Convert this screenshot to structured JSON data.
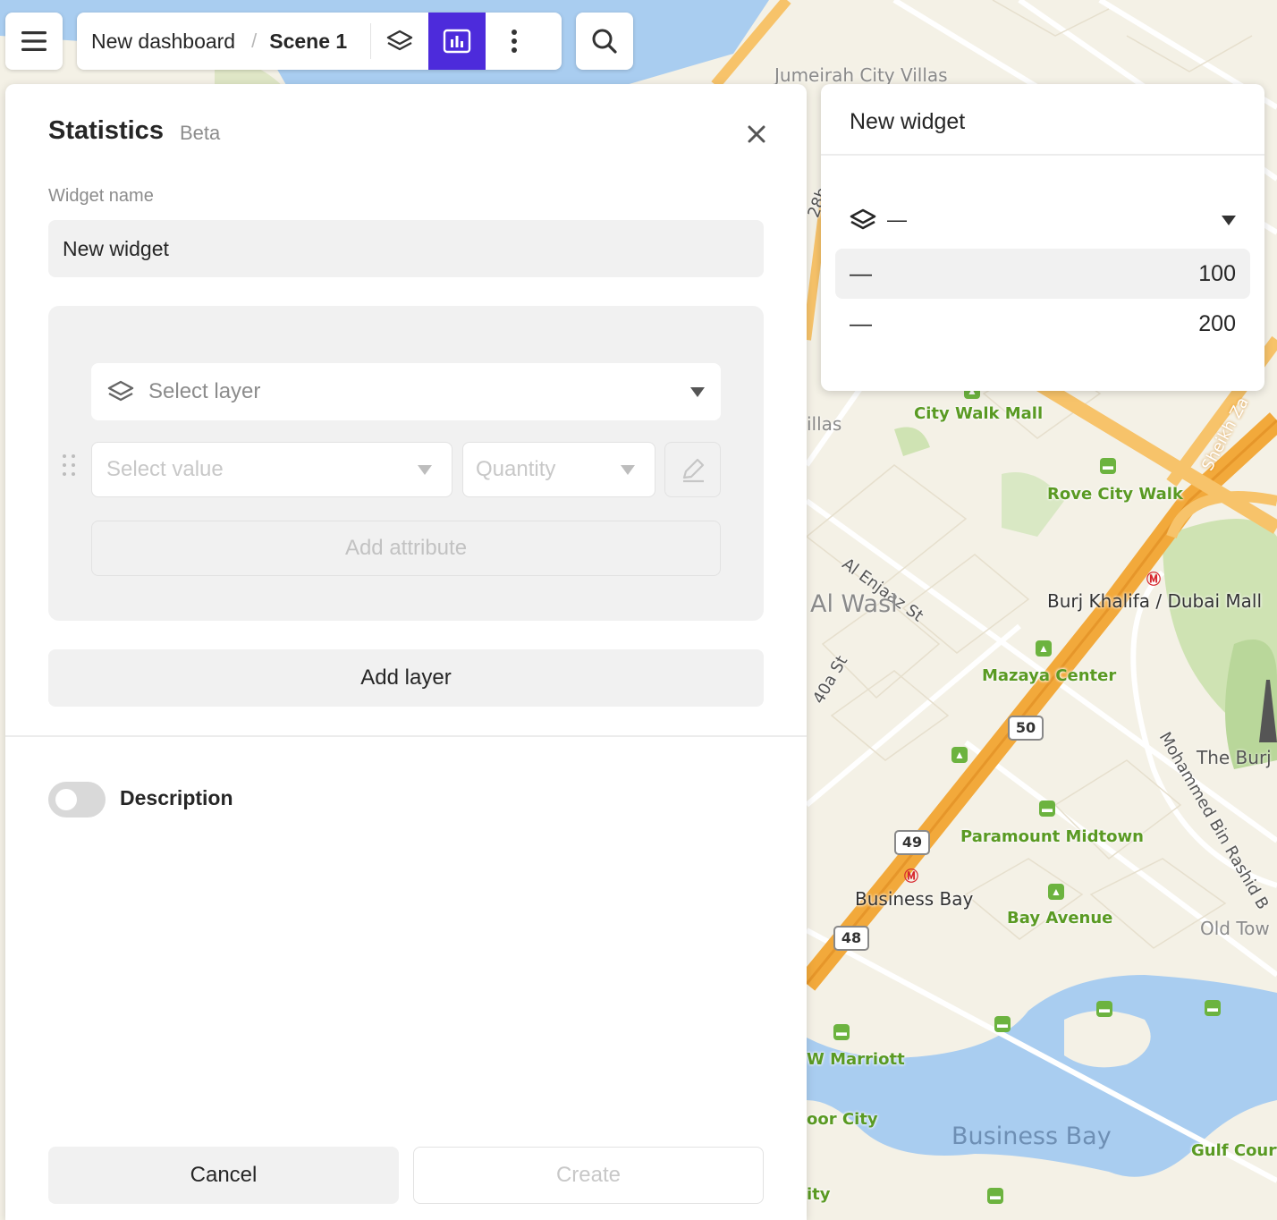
{
  "toolbar": {
    "dashboard_name": "New dashboard",
    "separator": "/",
    "scene_name": "Scene 1",
    "icons": [
      "menu-icon",
      "layers-icon",
      "widgets-chart-icon",
      "more-vertical-icon",
      "search-icon"
    ],
    "accent_color": "#4d2bdb"
  },
  "panel": {
    "title": "Statistics",
    "badge": "Beta",
    "widget_name_label": "Widget name",
    "widget_name_value": "New widget",
    "select_layer_placeholder": "Select layer",
    "select_value_placeholder": "Select value",
    "quantity_placeholder": "Quantity",
    "add_attribute_label": "Add attribute",
    "add_layer_label": "Add layer",
    "description_label": "Description",
    "description_enabled": false,
    "cancel_label": "Cancel",
    "create_label": "Create"
  },
  "preview": {
    "title": "New widget",
    "layer_value": "—",
    "rows": [
      {
        "label": "—",
        "value": "100"
      },
      {
        "label": "—",
        "value": "200"
      }
    ]
  },
  "map": {
    "labels": {
      "jumeirah_city_villas": "Jumeirah City Villas",
      "city_walk_mall": "City Walk Mall",
      "rove_city_walk": "Rove City Walk",
      "al_enjaaz_st": "Al Enjaaz St",
      "al_wasl": "Al Wasl",
      "burj_khalifa_dubai_mall": "Burj Khalifa / Dubai Mall",
      "mazaya_center": "Mazaya Center",
      "st_40a": "40a St",
      "sheikh_za": "Sheikh Za",
      "the_burj": "The Burj",
      "mohammed_bin_rashid": "Mohammed Bin Rashid B",
      "paramount_midtown": "Paramount Midtown",
      "business_bay_metro": "Business Bay",
      "bay_avenue": "Bay Avenue",
      "old_town": "Old Tow",
      "w_marriott": "W Marriott",
      "or_city": "oor City",
      "business_bay_district": "Business Bay",
      "gulf_court": "Gulf Court",
      "ity": "ity",
      "villas_partial": "illas",
      "st_28b": "28b"
    },
    "route_shields": [
      "50",
      "49",
      "48"
    ]
  }
}
